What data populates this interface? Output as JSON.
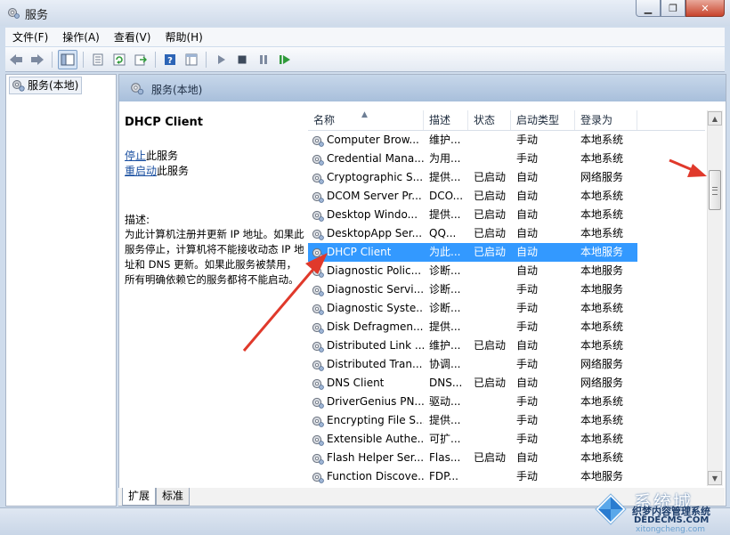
{
  "window": {
    "title": "服务",
    "minimize_symbol": "▁",
    "maximize_symbol": "❐",
    "close_symbol": "✕"
  },
  "menu": [
    "文件(F)",
    "操作(A)",
    "查看(V)",
    "帮助(H)"
  ],
  "toolbar": {
    "icons": [
      "back-icon",
      "forward-icon",
      "show-hide-tree-icon",
      "properties-icon",
      "refresh-icon",
      "export-icon",
      "help-icon",
      "view-icon",
      "start-icon",
      "stop-icon",
      "pause-icon",
      "restart-icon"
    ]
  },
  "tree": {
    "root_label": "服务(本地)"
  },
  "panel": {
    "header_title": "服务(本地)",
    "selected_service": "DHCP Client",
    "stop_link": "停止",
    "stop_suffix": "此服务",
    "restart_link": "重启动",
    "restart_suffix": "此服务",
    "description_label": "描述:",
    "description_text": "为此计算机注册并更新 IP 地址。如果此服务停止，计算机将不能接收动态 IP 地址和 DNS 更新。如果此服务被禁用，所有明确依赖它的服务都将不能启动。"
  },
  "table": {
    "columns": {
      "name": "名称",
      "desc": "描述",
      "status": "状态",
      "startup": "启动类型",
      "logon": "登录为"
    },
    "sort_indicator": "▲",
    "rows": [
      {
        "name": "Computer Brow...",
        "desc": "维护...",
        "status": "",
        "startup": "手动",
        "logon": "本地系统"
      },
      {
        "name": "Credential Mana...",
        "desc": "为用...",
        "status": "",
        "startup": "手动",
        "logon": "本地系统"
      },
      {
        "name": "Cryptographic S...",
        "desc": "提供...",
        "status": "已启动",
        "startup": "自动",
        "logon": "网络服务"
      },
      {
        "name": "DCOM Server Pr...",
        "desc": "DCO...",
        "status": "已启动",
        "startup": "自动",
        "logon": "本地系统"
      },
      {
        "name": "Desktop Windo...",
        "desc": "提供...",
        "status": "已启动",
        "startup": "自动",
        "logon": "本地系统"
      },
      {
        "name": "DesktopApp Ser...",
        "desc": "QQ...",
        "status": "已启动",
        "startup": "自动",
        "logon": "本地系统"
      },
      {
        "name": "DHCP Client",
        "desc": "为此...",
        "status": "已启动",
        "startup": "自动",
        "logon": "本地服务",
        "selected": true
      },
      {
        "name": "Diagnostic Polic...",
        "desc": "诊断...",
        "status": "",
        "startup": "自动",
        "logon": "本地服务"
      },
      {
        "name": "Diagnostic Servi...",
        "desc": "诊断...",
        "status": "",
        "startup": "手动",
        "logon": "本地服务"
      },
      {
        "name": "Diagnostic Syste...",
        "desc": "诊断...",
        "status": "",
        "startup": "手动",
        "logon": "本地系统"
      },
      {
        "name": "Disk Defragmen...",
        "desc": "提供...",
        "status": "",
        "startup": "手动",
        "logon": "本地系统"
      },
      {
        "name": "Distributed Link ...",
        "desc": "维护...",
        "status": "已启动",
        "startup": "自动",
        "logon": "本地系统"
      },
      {
        "name": "Distributed Tran...",
        "desc": "协调...",
        "status": "",
        "startup": "手动",
        "logon": "网络服务"
      },
      {
        "name": "DNS Client",
        "desc": "DNS...",
        "status": "已启动",
        "startup": "自动",
        "logon": "网络服务"
      },
      {
        "name": "DriverGenius PN...",
        "desc": "驱动...",
        "status": "",
        "startup": "手动",
        "logon": "本地系统"
      },
      {
        "name": "Encrypting File S...",
        "desc": "提供...",
        "status": "",
        "startup": "手动",
        "logon": "本地系统"
      },
      {
        "name": "Extensible Authe...",
        "desc": "可扩...",
        "status": "",
        "startup": "手动",
        "logon": "本地系统"
      },
      {
        "name": "Flash Helper Ser...",
        "desc": "Flas...",
        "status": "已启动",
        "startup": "自动",
        "logon": "本地系统"
      },
      {
        "name": "Function Discove...",
        "desc": "FDP...",
        "status": "",
        "startup": "手动",
        "logon": "本地服务"
      }
    ]
  },
  "scrollbar": {
    "up_symbol": "▲",
    "down_symbol": "▼",
    "position_fraction": 0.15
  },
  "tabs": {
    "extended": "扩展",
    "standard": "标准"
  },
  "watermark": {
    "brand": "系统城",
    "line1": "织梦内容管理系统",
    "line2": "DEDECMS.COM",
    "line3": "xitongcheng.com"
  },
  "colors": {
    "selection": "#3399ff",
    "link": "#1a4fa0",
    "annotation_arrow": "#e0392b"
  }
}
